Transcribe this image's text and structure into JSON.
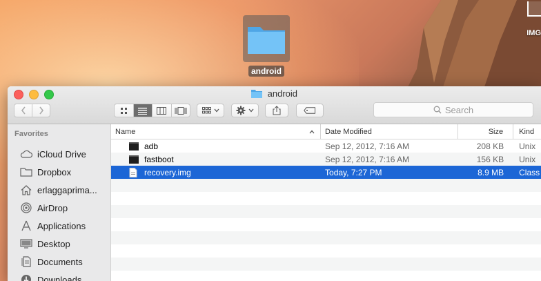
{
  "desktop": {
    "folder_label": "android",
    "peek_label": "IMG"
  },
  "window": {
    "title": "android",
    "search_placeholder": "Search"
  },
  "sidebar": {
    "section": "Favorites",
    "items": [
      {
        "label": "iCloud Drive",
        "icon": "cloud-icon"
      },
      {
        "label": "Dropbox",
        "icon": "folder-icon"
      },
      {
        "label": "erlaggaprima...",
        "icon": "home-icon"
      },
      {
        "label": "AirDrop",
        "icon": "airdrop-icon"
      },
      {
        "label": "Applications",
        "icon": "applications-icon"
      },
      {
        "label": "Desktop",
        "icon": "desktop-icon"
      },
      {
        "label": "Documents",
        "icon": "documents-icon"
      },
      {
        "label": "Downloads",
        "icon": "downloads-icon"
      }
    ]
  },
  "columns": {
    "name": "Name",
    "date": "Date Modified",
    "size": "Size",
    "kind": "Kind"
  },
  "files": [
    {
      "name": "adb",
      "date": "Sep 12, 2012, 7:16 AM",
      "size": "208 KB",
      "kind": "Unix",
      "icon": "terminal-icon"
    },
    {
      "name": "fastboot",
      "date": "Sep 12, 2012, 7:16 AM",
      "size": "156 KB",
      "kind": "Unix",
      "icon": "terminal-icon"
    },
    {
      "name": "recovery.img",
      "date": "Today, 7:27 PM",
      "size": "8.9 MB",
      "kind": "Class",
      "icon": "document-icon"
    }
  ],
  "colors": {
    "selection": "#1c66d6",
    "folder": "#5fb6f0"
  }
}
